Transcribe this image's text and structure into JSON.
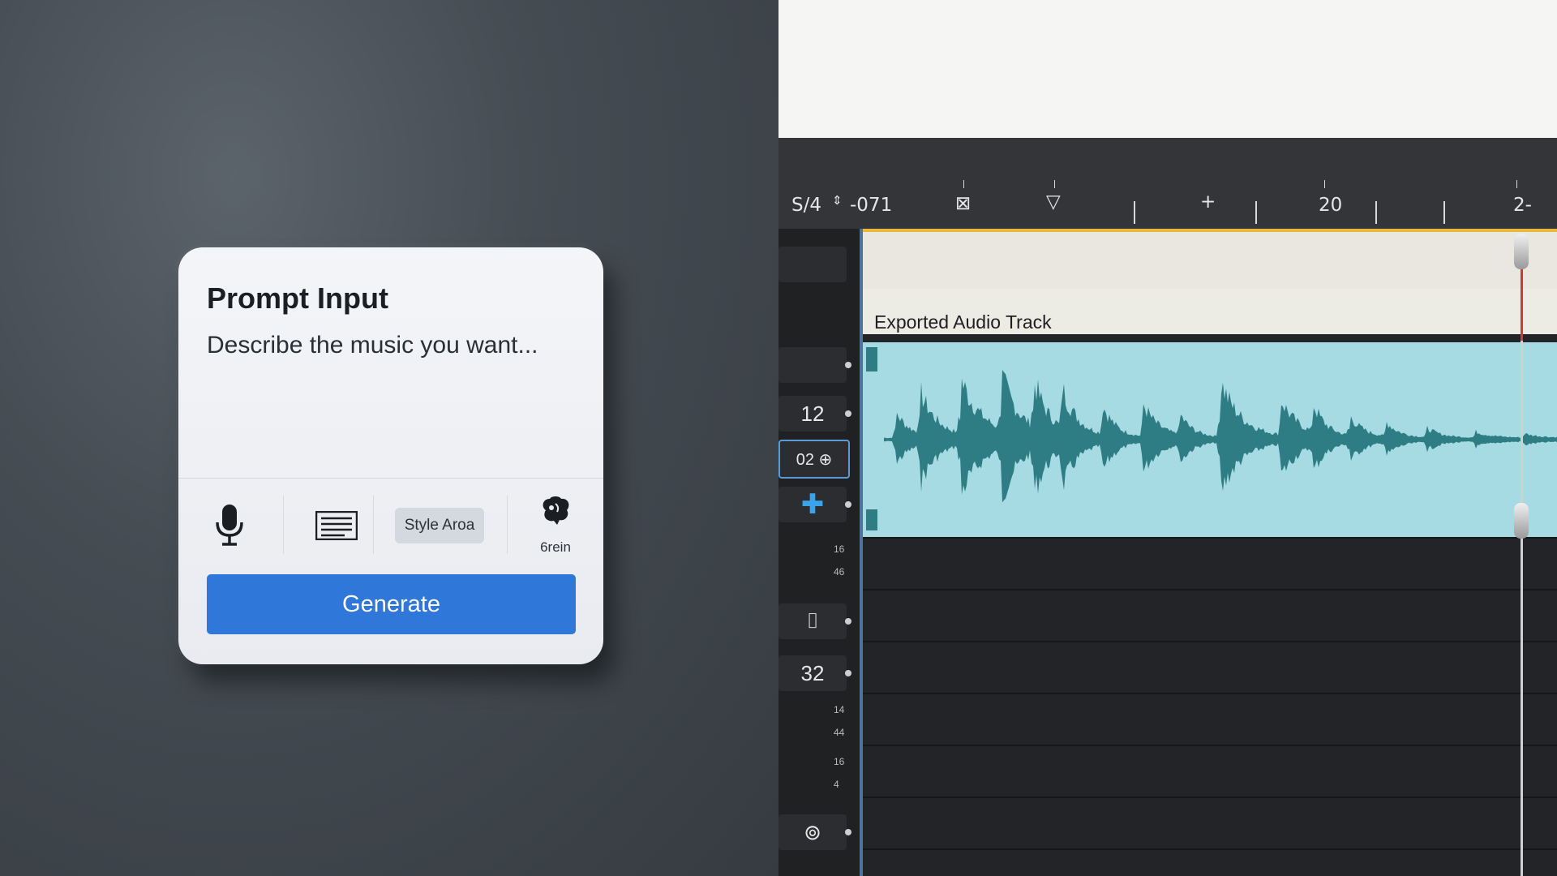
{
  "prompt_card": {
    "title": "Prompt Input",
    "placeholder": "Describe the music you want...",
    "tools": [
      {
        "icon": "microphone-icon"
      },
      {
        "icon": "text-lines-icon"
      },
      {
        "label": "Style Aroa"
      },
      {
        "icon": "brain-icon",
        "label": "6rein"
      }
    ],
    "generate_label": "Generate",
    "accent_color": "#2f77d8"
  },
  "daw": {
    "ruler": {
      "left_text": "S/4",
      "position_text": "-071",
      "marker_20": "20",
      "marker_end": "2-"
    },
    "track_title": "Exported Audio Track",
    "track_buttons": [
      {
        "label": ""
      },
      {
        "label": "12"
      },
      {
        "label": "02 ⊕"
      },
      {
        "label": "✚"
      },
      {
        "label": "⌷"
      },
      {
        "label": "32"
      },
      {
        "label": "⊚"
      }
    ],
    "small_numbers": [
      "16",
      "46",
      "14",
      "44",
      "16",
      "4"
    ],
    "waveform_color": "#2f7d84",
    "waveform_bg": "#a7dbe3"
  }
}
